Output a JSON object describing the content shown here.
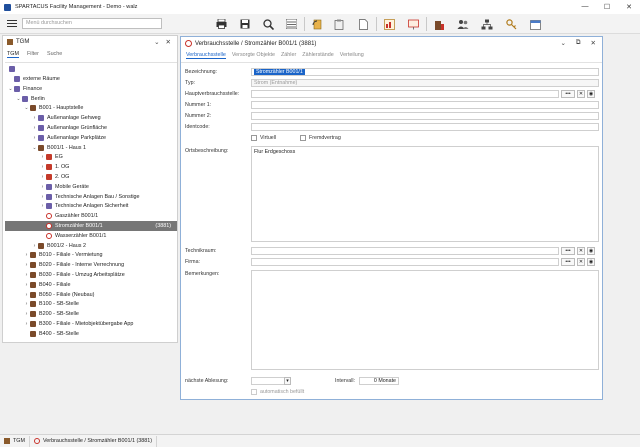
{
  "app": {
    "title": "SPARTACUS Facility Management - Demo - walz",
    "minimize": "—",
    "maximize": "☐",
    "close": "✕"
  },
  "toolbar": {
    "search_placeholder": "Menü durchsuchen"
  },
  "left_panel": {
    "title": "TGM",
    "controls": {
      "collapse": "⌄",
      "close": "✕"
    },
    "tabs": [
      "TGM",
      "Filter",
      "Suche"
    ],
    "tree": [
      {
        "label": "",
        "depth": 0,
        "icon": "grp",
        "arrow": ""
      },
      {
        "label": "externe Räume",
        "depth": 0,
        "icon": "grp",
        "arrow": ""
      },
      {
        "label": "Finance",
        "depth": 0,
        "icon": "grp",
        "arrow": "⌄"
      },
      {
        "label": "Berlin",
        "depth": 1,
        "icon": "grp",
        "arrow": "⌄"
      },
      {
        "label": "B001 - Hauptstelle",
        "depth": 2,
        "icon": "bld",
        "arrow": "⌄"
      },
      {
        "label": "Außenanlage Gehweg",
        "depth": 3,
        "icon": "grp",
        "arrow": "›"
      },
      {
        "label": "Außenanlage Grünfläche",
        "depth": 3,
        "icon": "grp",
        "arrow": "›"
      },
      {
        "label": "Außenanlage Parkplätze",
        "depth": 3,
        "icon": "grp",
        "arrow": "›"
      },
      {
        "label": "B001/1 - Haus 1",
        "depth": 3,
        "icon": "bld",
        "arrow": "⌄"
      },
      {
        "label": "EG",
        "depth": 4,
        "icon": "flag",
        "arrow": "›"
      },
      {
        "label": "1. OG",
        "depth": 4,
        "icon": "flag",
        "arrow": "›"
      },
      {
        "label": "2. OG",
        "depth": 4,
        "icon": "flag",
        "arrow": "›"
      },
      {
        "label": "Mobile Geräte",
        "depth": 4,
        "icon": "grp",
        "arrow": "›"
      },
      {
        "label": "Technische Anlagen Bau / Sonstige",
        "depth": 4,
        "icon": "grp",
        "arrow": "›"
      },
      {
        "label": "Technische Anlagen Sicherheit",
        "depth": 4,
        "icon": "grp",
        "arrow": "›"
      },
      {
        "label": "Gaszähler B001/1",
        "depth": 4,
        "icon": "meter",
        "arrow": ""
      },
      {
        "label": "Stromzähler B001/1",
        "depth": 4,
        "icon": "meter",
        "arrow": "",
        "count": "(3881)",
        "selected": true
      },
      {
        "label": "Wasserzähler B001/1",
        "depth": 4,
        "icon": "meter",
        "arrow": ""
      },
      {
        "label": "B001/2 - Haus 2",
        "depth": 3,
        "icon": "bld",
        "arrow": "›"
      },
      {
        "label": "B010 - Filiale - Vermietung",
        "depth": 2,
        "icon": "bld",
        "arrow": "›"
      },
      {
        "label": "B020 - Filiale - Interne Verrechnung",
        "depth": 2,
        "icon": "bld",
        "arrow": "›"
      },
      {
        "label": "B030 - Filiale - Umzug Arbeitsplätze",
        "depth": 2,
        "icon": "bld",
        "arrow": "›"
      },
      {
        "label": "B040 - Filiale",
        "depth": 2,
        "icon": "bld",
        "arrow": "›"
      },
      {
        "label": "B050 - Filiale (Neubau)",
        "depth": 2,
        "icon": "bld",
        "arrow": "›"
      },
      {
        "label": "B100 - SB-Stelle",
        "depth": 2,
        "icon": "bld",
        "arrow": "›"
      },
      {
        "label": "B200 - SB-Stelle",
        "depth": 2,
        "icon": "bld",
        "arrow": "›"
      },
      {
        "label": "B300 - Filiale - Mietobjektübergabe App",
        "depth": 2,
        "icon": "bld",
        "arrow": "›"
      },
      {
        "label": "B400 - SB-Stelle",
        "depth": 2,
        "icon": "bld",
        "arrow": ""
      }
    ]
  },
  "window": {
    "title": "Verbrauchsstelle / Stromzähler B001/1 (3881)",
    "controls": {
      "collapse": "⌄",
      "restore": "⧉",
      "close": "✕"
    },
    "tabs": [
      "Verbrauchsstelle",
      "Versorgte Objekte",
      "Zähler",
      "Zählerstände",
      "Verteilung"
    ],
    "form": {
      "bezeichnung_label": "Bezeichnung:",
      "bezeichnung_value": "Stromzähler B001/1",
      "typ_label": "Typ:",
      "typ_value": "Strom (Entnahme)",
      "haupt_label": "Hauptverbrauchsstelle:",
      "nummer1_label": "Nummer 1:",
      "nummer2_label": "Nummer 2:",
      "identcode_label": "Identcode:",
      "virtuell_label": "Virtuell",
      "fremdvertrag_label": "Fremdvertrag",
      "ort_label": "Ortsbeschreibung:",
      "ort_value": "Flur Erdgeschoss",
      "technikraum_label": "Technikraum:",
      "firma_label": "Firma:",
      "bemerkungen_label": "Bemerkungen:",
      "ablesung_label": "nächste Ablesung:",
      "ablesung_picker": "▾",
      "intervall_label": "Intervall:",
      "intervall_value": "0 Monate",
      "auto_label": "automatisch befüllt",
      "dots": "•••"
    }
  },
  "taskbar": {
    "items": [
      "TGM",
      "Verbrauchsstelle / Stromzähler B001/1 (3881)"
    ]
  }
}
